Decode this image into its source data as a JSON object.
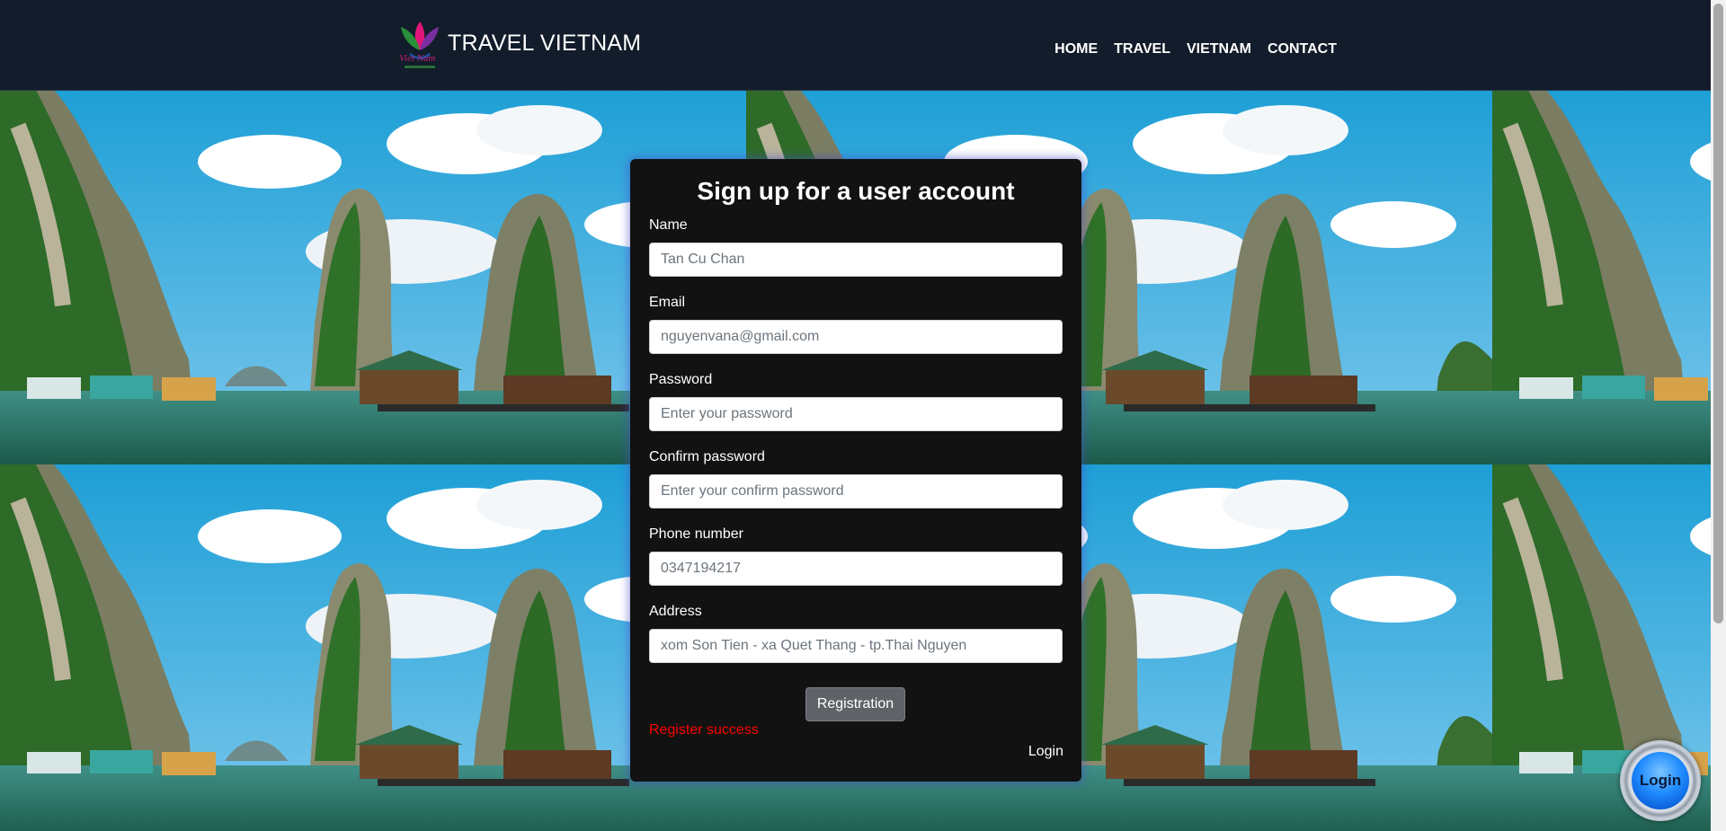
{
  "header": {
    "brand_title": "TRAVEL VIETNAM",
    "nav": [
      "HOME",
      "TRAVEL",
      "VIETNAM",
      "CONTACT"
    ]
  },
  "form": {
    "title": "Sign up for a user account",
    "fields": [
      {
        "label": "Name",
        "placeholder": "Tan Cu Chan"
      },
      {
        "label": "Email",
        "placeholder": "nguyenvana@gmail.com"
      },
      {
        "label": "Password",
        "placeholder": "Enter your password"
      },
      {
        "label": "Confirm password",
        "placeholder": "Enter your confirm password"
      },
      {
        "label": "Phone number",
        "placeholder": "0347194217"
      },
      {
        "label": "Address",
        "placeholder": "xom Son Tien - xa Quet Thang - tp.Thai Nguyen"
      }
    ],
    "submit_label": "Registration",
    "status_message": "Register success",
    "login_link": "Login"
  },
  "floating_login_label": "Login",
  "colors": {
    "header_bg": "#121c2a",
    "panel_bg": "#121212",
    "status_color": "#ff0000",
    "button_bg": "#5f6368",
    "fab_blue": "#1f8cff"
  },
  "icons": [
    "lotus-logo-icon"
  ]
}
